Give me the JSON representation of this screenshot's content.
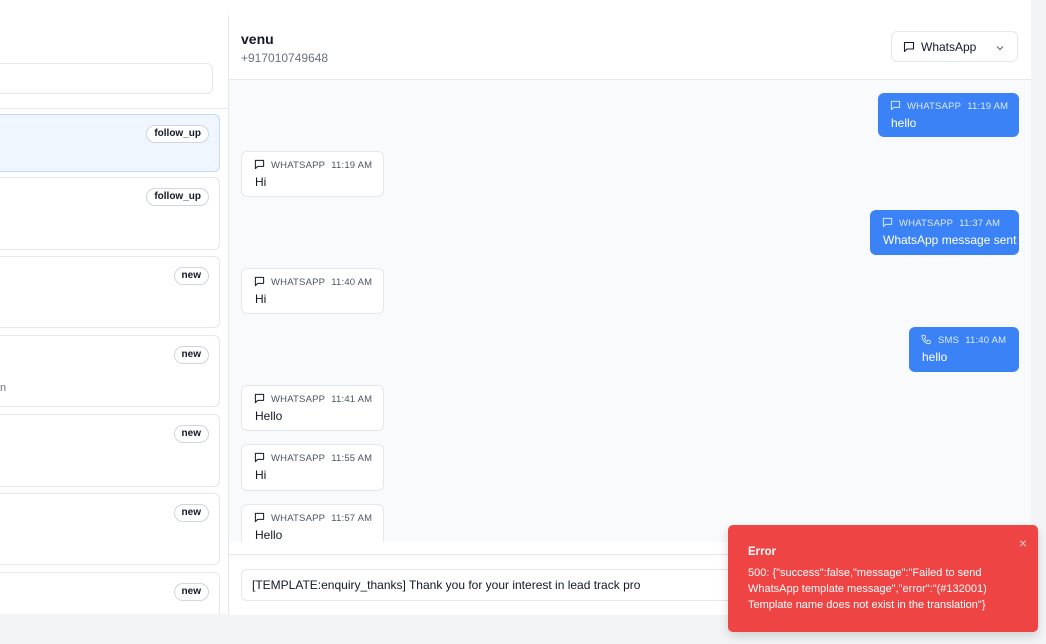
{
  "lead_list": {
    "cards": [
      {
        "badge": "follow_up",
        "fragment": ""
      },
      {
        "badge": "follow_up",
        "fragment": ""
      },
      {
        "badge": "new",
        "fragment": ""
      },
      {
        "badge": "new",
        "fragment": "n"
      },
      {
        "badge": "new",
        "fragment": ""
      },
      {
        "badge": "new",
        "fragment": ""
      },
      {
        "badge": "new",
        "fragment": ""
      }
    ]
  },
  "header": {
    "contact_name": "venu",
    "contact_phone": "+917010749648",
    "channel_label": "WhatsApp"
  },
  "messages": [
    {
      "channel": "WHATSAPP",
      "time": "11:19 AM",
      "text": "hello",
      "direction": "out",
      "icon": "message-square-icon"
    },
    {
      "channel": "WHATSAPP",
      "time": "11:19 AM",
      "text": "Hi",
      "direction": "in",
      "icon": "message-square-icon"
    },
    {
      "channel": "WHATSAPP",
      "time": "11:37 AM",
      "text": "WhatsApp message sent",
      "direction": "out",
      "icon": "message-square-icon"
    },
    {
      "channel": "WHATSAPP",
      "time": "11:40 AM",
      "text": "Hi",
      "direction": "in",
      "icon": "message-square-icon"
    },
    {
      "channel": "SMS",
      "time": "11:40 AM",
      "text": "hello",
      "direction": "out",
      "icon": "phone-icon"
    },
    {
      "channel": "WHATSAPP",
      "time": "11:41 AM",
      "text": "Hello",
      "direction": "in",
      "icon": "message-square-icon"
    },
    {
      "channel": "WHATSAPP",
      "time": "11:55 AM",
      "text": "Hi",
      "direction": "in",
      "icon": "message-square-icon"
    },
    {
      "channel": "WHATSAPP",
      "time": "11:57 AM",
      "text": "Hello",
      "direction": "in",
      "icon": "message-square-icon"
    }
  ],
  "composer": {
    "value": "[TEMPLATE:enquiry_thanks] Thank you for your interest in lead track pro"
  },
  "toast": {
    "title": "Error",
    "message": "500: {\"success\":false,\"message\":\"Failed to send WhatsApp template message\",\"error\":\"(#132001) Template name does not exist in the translation\"}",
    "close": "×"
  },
  "colors": {
    "accent": "#3b82f6",
    "error": "#ef4444",
    "active_card": "#eff6ff"
  }
}
